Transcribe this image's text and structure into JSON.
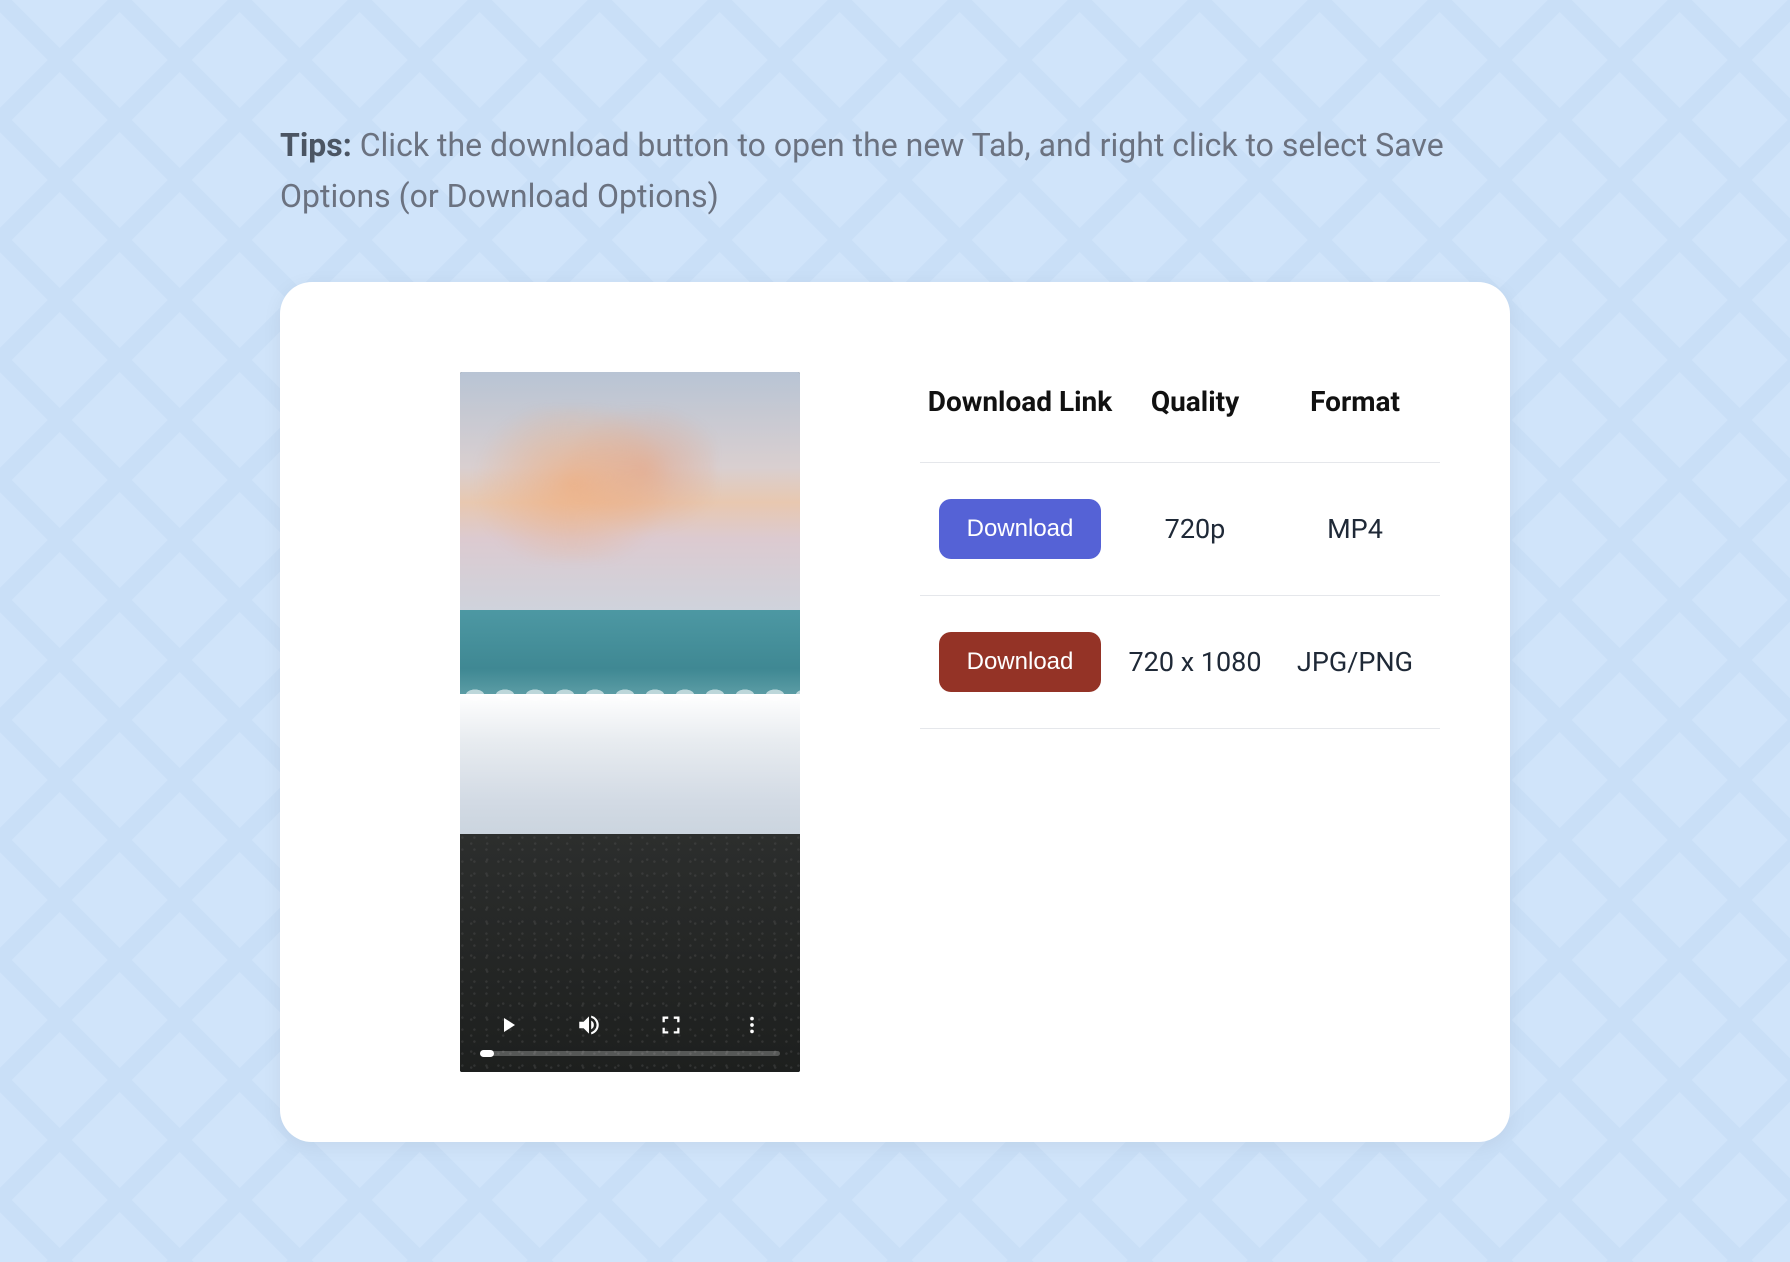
{
  "tips": {
    "label": "Tips:",
    "text": "Click the download button to open the new Tab, and right click to select Save Options (or Download Options)"
  },
  "player": {
    "play_icon": "play-icon",
    "volume_icon": "volume-icon",
    "fullscreen_icon": "fullscreen-icon",
    "more_icon": "more-icon"
  },
  "table": {
    "headers": {
      "link": "Download Link",
      "quality": "Quality",
      "format": "Format"
    },
    "rows": [
      {
        "button": "Download",
        "button_style": "blue",
        "quality": "720p",
        "format": "MP4"
      },
      {
        "button": "Download",
        "button_style": "red",
        "quality": "720 x 1080",
        "format": "JPG/PNG"
      }
    ]
  }
}
